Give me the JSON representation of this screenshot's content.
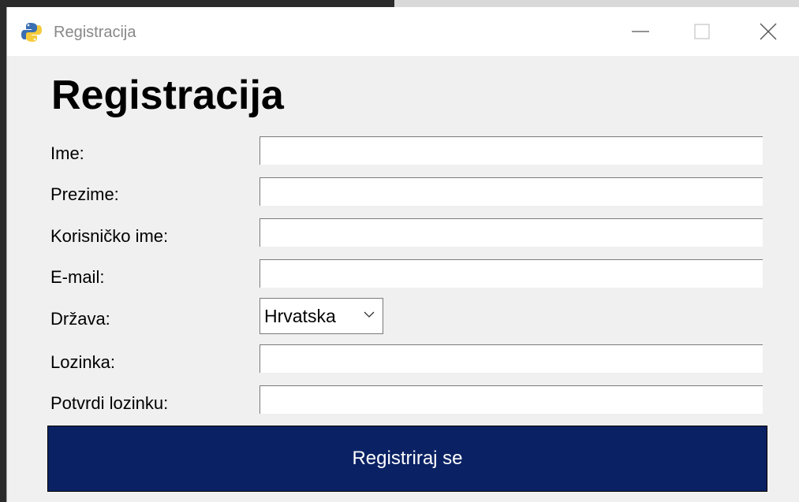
{
  "window": {
    "title": "Registracija"
  },
  "form": {
    "heading": "Registracija",
    "fields": [
      {
        "label": "Ime:",
        "value": ""
      },
      {
        "label": "Prezime:",
        "value": ""
      },
      {
        "label": "Korisničko ime:",
        "value": ""
      },
      {
        "label": "E-mail:",
        "value": ""
      },
      {
        "label": "Država:",
        "value": "Hrvatska"
      },
      {
        "label": "Lozinka:",
        "value": ""
      },
      {
        "label": "Potvrdi lozinku:",
        "value": ""
      }
    ],
    "submit_label": "Registriraj se"
  },
  "icons": {
    "app": "python-logo-icon",
    "minimize": "minimize-icon",
    "maximize": "maximize-icon",
    "close": "close-icon",
    "dropdown": "chevron-down-icon"
  },
  "colors": {
    "button_background": "#0a2264",
    "button_text": "#ffffff",
    "window_background": "#f0f0f0"
  }
}
